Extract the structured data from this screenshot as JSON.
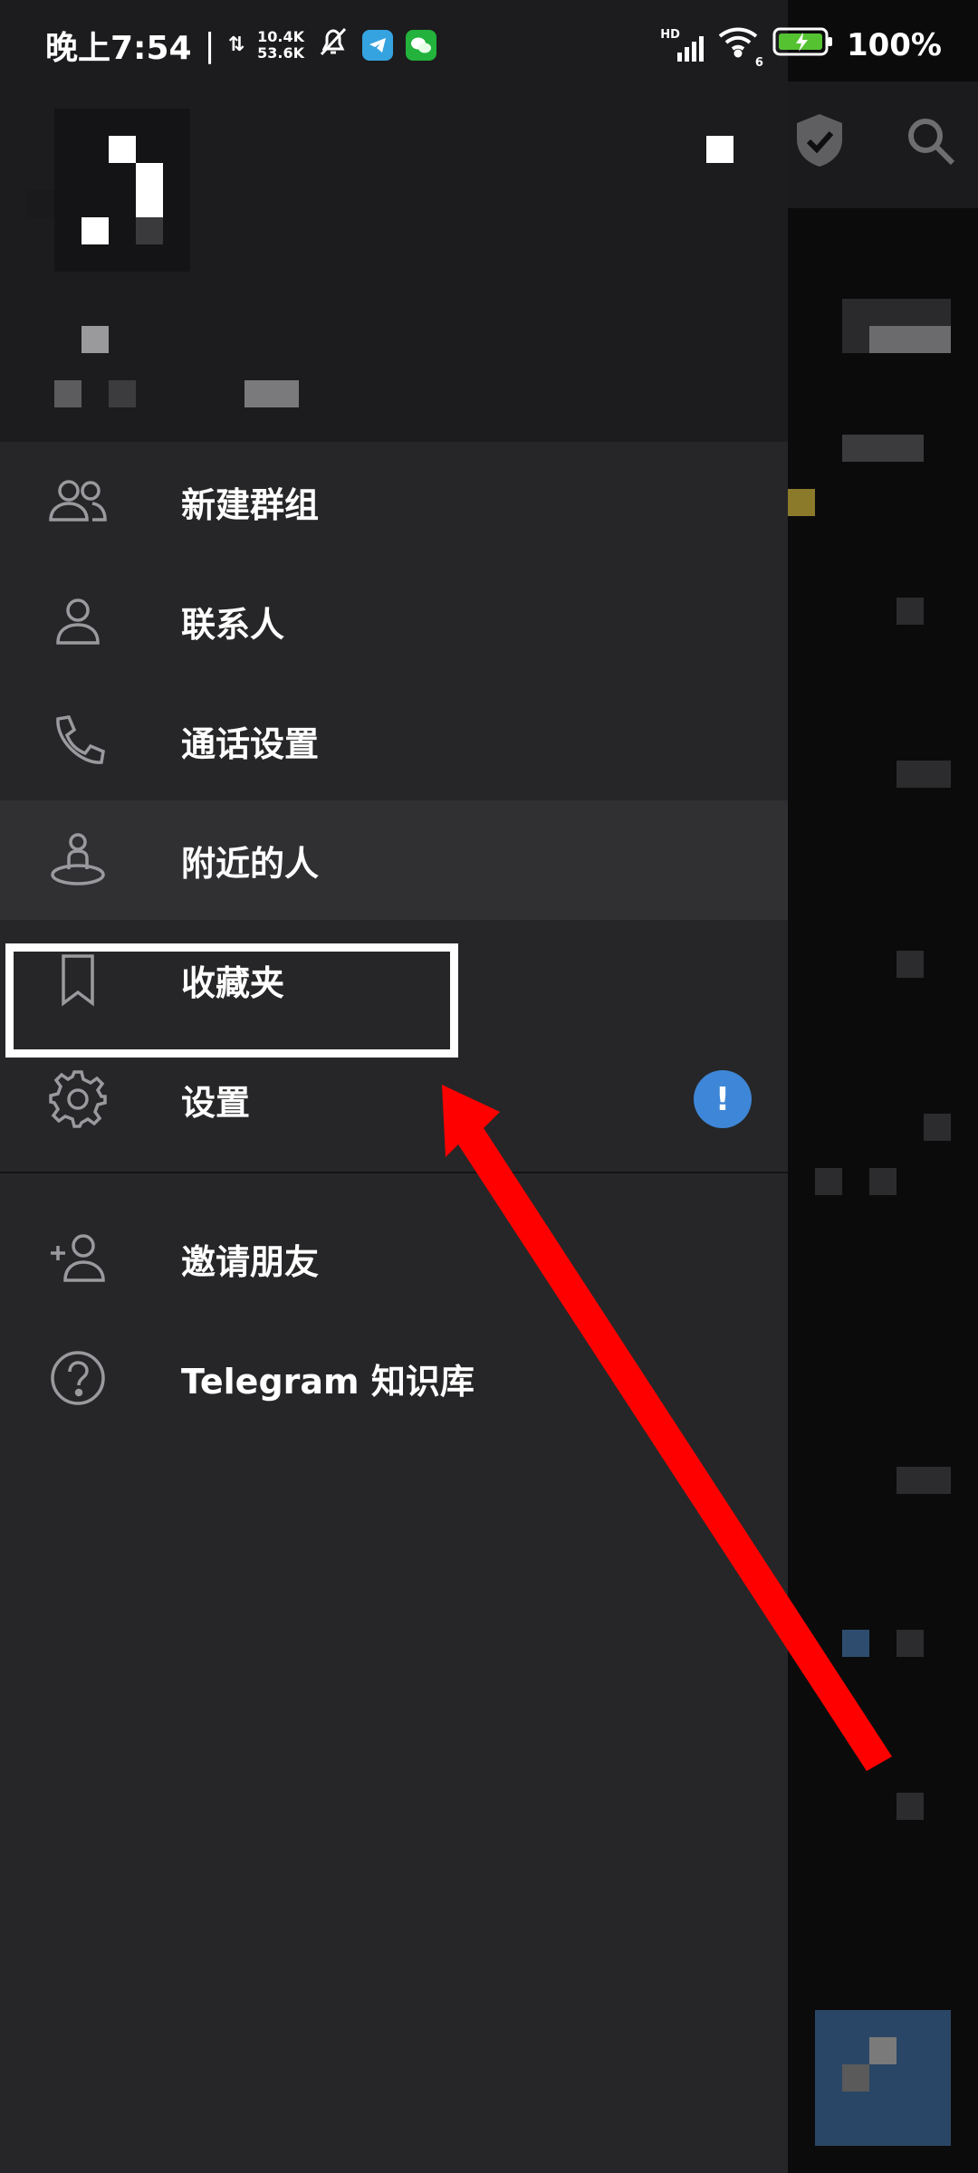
{
  "status_bar": {
    "time": "晚上7:54",
    "upload_speed": "10.4K",
    "download_speed": "53.6K",
    "network_label": "HD",
    "wifi_label": "6",
    "battery": "100%"
  },
  "menu": {
    "items": [
      {
        "label": "新建群组",
        "icon": "group-icon"
      },
      {
        "label": "联系人",
        "icon": "contact-icon"
      },
      {
        "label": "通话设置",
        "icon": "phone-icon"
      },
      {
        "label": "附近的人",
        "icon": "nearby-people-icon"
      },
      {
        "label": "收藏夹",
        "icon": "bookmark-icon"
      },
      {
        "label": "设置",
        "icon": "gear-icon",
        "badge": "!"
      }
    ],
    "secondary_items": [
      {
        "label": "邀请朋友",
        "icon": "add-user-icon"
      },
      {
        "label": "Telegram 知识库",
        "icon": "help-icon"
      }
    ]
  },
  "colors": {
    "drawer_bg": "#262628",
    "header_bg": "#1c1c1e",
    "badge": "#3e86d7",
    "annotation": "#ff0000"
  }
}
